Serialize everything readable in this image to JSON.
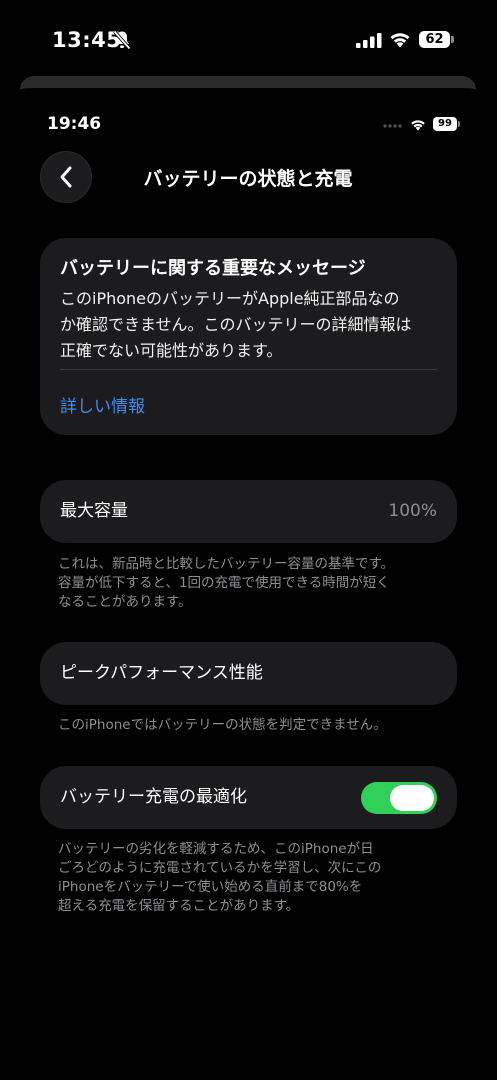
{
  "outer_status": {
    "time": "13:45",
    "battery": "62"
  },
  "inner_status": {
    "time": "19:46",
    "battery": "99"
  },
  "nav": {
    "title": "バッテリーの状態と充電"
  },
  "message_card": {
    "title": "バッテリーに関する重要なメッセージ",
    "body_lines": [
      "このiPhoneのバッテリーがApple純正部品なの",
      "か確認できません。このバッテリーの詳細情報は",
      "正確でない可能性があります。"
    ],
    "link": "詳しい情報"
  },
  "capacity": {
    "label": "最大容量",
    "value": "100%",
    "footnote_lines": [
      "これは、新品時と比較したバッテリー容量の基準です。",
      "容量が低下すると、1回の充電で使用できる時間が短く",
      "なることがあります。"
    ]
  },
  "peak": {
    "label": "ピークパフォーマンス性能",
    "footnote_lines": [
      "このiPhoneではバッテリーの状態を判定できません。"
    ]
  },
  "optimize": {
    "label": "バッテリー充電の最適化",
    "enabled": true,
    "footnote_lines": [
      "バッテリーの劣化を軽減するため、このiPhoneが日",
      "ごろどのように充電されているかを学習し、次にこの",
      "iPhoneをバッテリーで使い始める直前まで80%を",
      "超える充電を保留することがあります。"
    ]
  },
  "colors": {
    "accent_link": "#3b8df5",
    "toggle_on": "#30d158",
    "card_bg": "#1c1c1e",
    "secondary_text": "#8e8e93"
  }
}
